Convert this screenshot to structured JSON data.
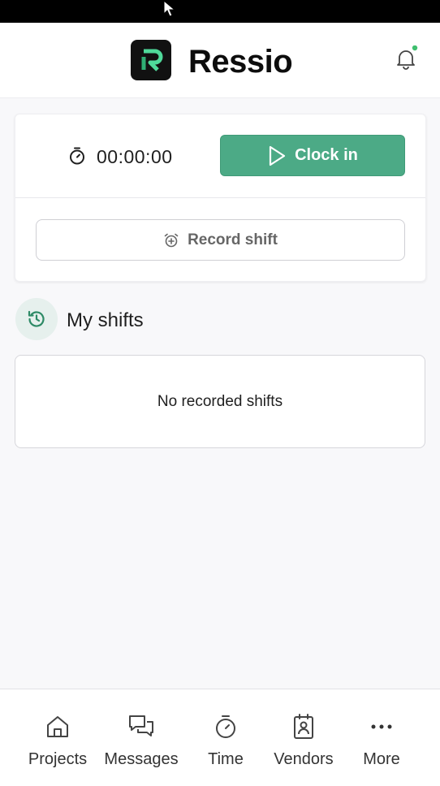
{
  "header": {
    "app_name": "Ressio",
    "logo_icon": "ressio-logo-icon",
    "notification_icon": "bell-icon",
    "notification_dot_color": "#3fbf6f"
  },
  "timer": {
    "icon": "stopwatch-icon",
    "value": "00:00:00",
    "clock_in_label": "Clock in",
    "clock_in_icon": "play-icon",
    "clock_in_color": "#4caa86",
    "record_label": "Record shift",
    "record_icon": "alarm-plus-icon"
  },
  "shifts": {
    "icon": "history-icon",
    "title": "My shifts",
    "empty_text": "No recorded shifts"
  },
  "nav": {
    "items": [
      {
        "label": "Projects",
        "icon": "home-icon"
      },
      {
        "label": "Messages",
        "icon": "chat-bubbles-icon"
      },
      {
        "label": "Time",
        "icon": "stopwatch-icon"
      },
      {
        "label": "Vendors",
        "icon": "contact-card-icon"
      },
      {
        "label": "More",
        "icon": "more-dots-icon"
      }
    ]
  }
}
